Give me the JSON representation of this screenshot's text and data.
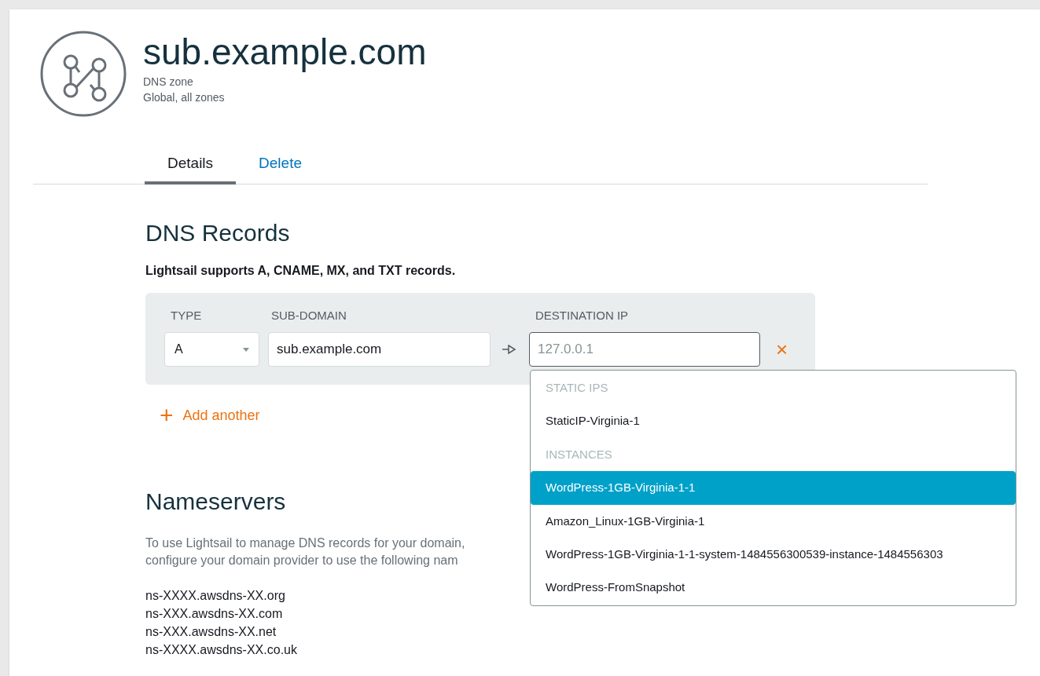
{
  "header": {
    "title": "sub.example.com",
    "subtitle": "DNS zone",
    "region": "Global, all zones"
  },
  "tabs": [
    {
      "label": "Details",
      "selected": true
    },
    {
      "label": "Delete",
      "selected": false
    }
  ],
  "records": {
    "heading": "DNS Records",
    "note": "Lightsail supports A, CNAME, MX, and TXT records.",
    "columns": [
      "TYPE",
      "SUB-DOMAIN",
      "DESTINATION IP"
    ],
    "row": {
      "type": "A",
      "subdomain": "sub.example.com",
      "destination_placeholder": "127.0.0.1",
      "remove": "×"
    },
    "add": {
      "icon": "+",
      "label": "Add another"
    }
  },
  "dropdown": [
    {
      "kind": "header",
      "label": "STATIC IPS"
    },
    {
      "kind": "option",
      "label": "StaticIP-Virginia-1",
      "selected": false
    },
    {
      "kind": "header",
      "label": "INSTANCES"
    },
    {
      "kind": "option",
      "label": "WordPress-1GB-Virginia-1-1",
      "selected": true
    },
    {
      "kind": "option",
      "label": "Amazon_Linux-1GB-Virginia-1",
      "selected": false
    },
    {
      "kind": "option",
      "label": "WordPress-1GB-Virginia-1-1-system-1484556300539-instance-1484556303",
      "selected": false
    },
    {
      "kind": "option",
      "label": "WordPress-FromSnapshot",
      "selected": false
    }
  ],
  "nameservers": {
    "heading": "Nameservers",
    "description": [
      "To use Lightsail to manage DNS records for your domain,",
      "configure your domain provider to use the following nam"
    ],
    "servers": [
      "ns-XXXX.awsdns-XX.org",
      "ns-XXX.awsdns-XX.com",
      "ns-XXX.awsdns-XX.net",
      "ns-XXXX.awsdns-XX.co.uk"
    ]
  }
}
